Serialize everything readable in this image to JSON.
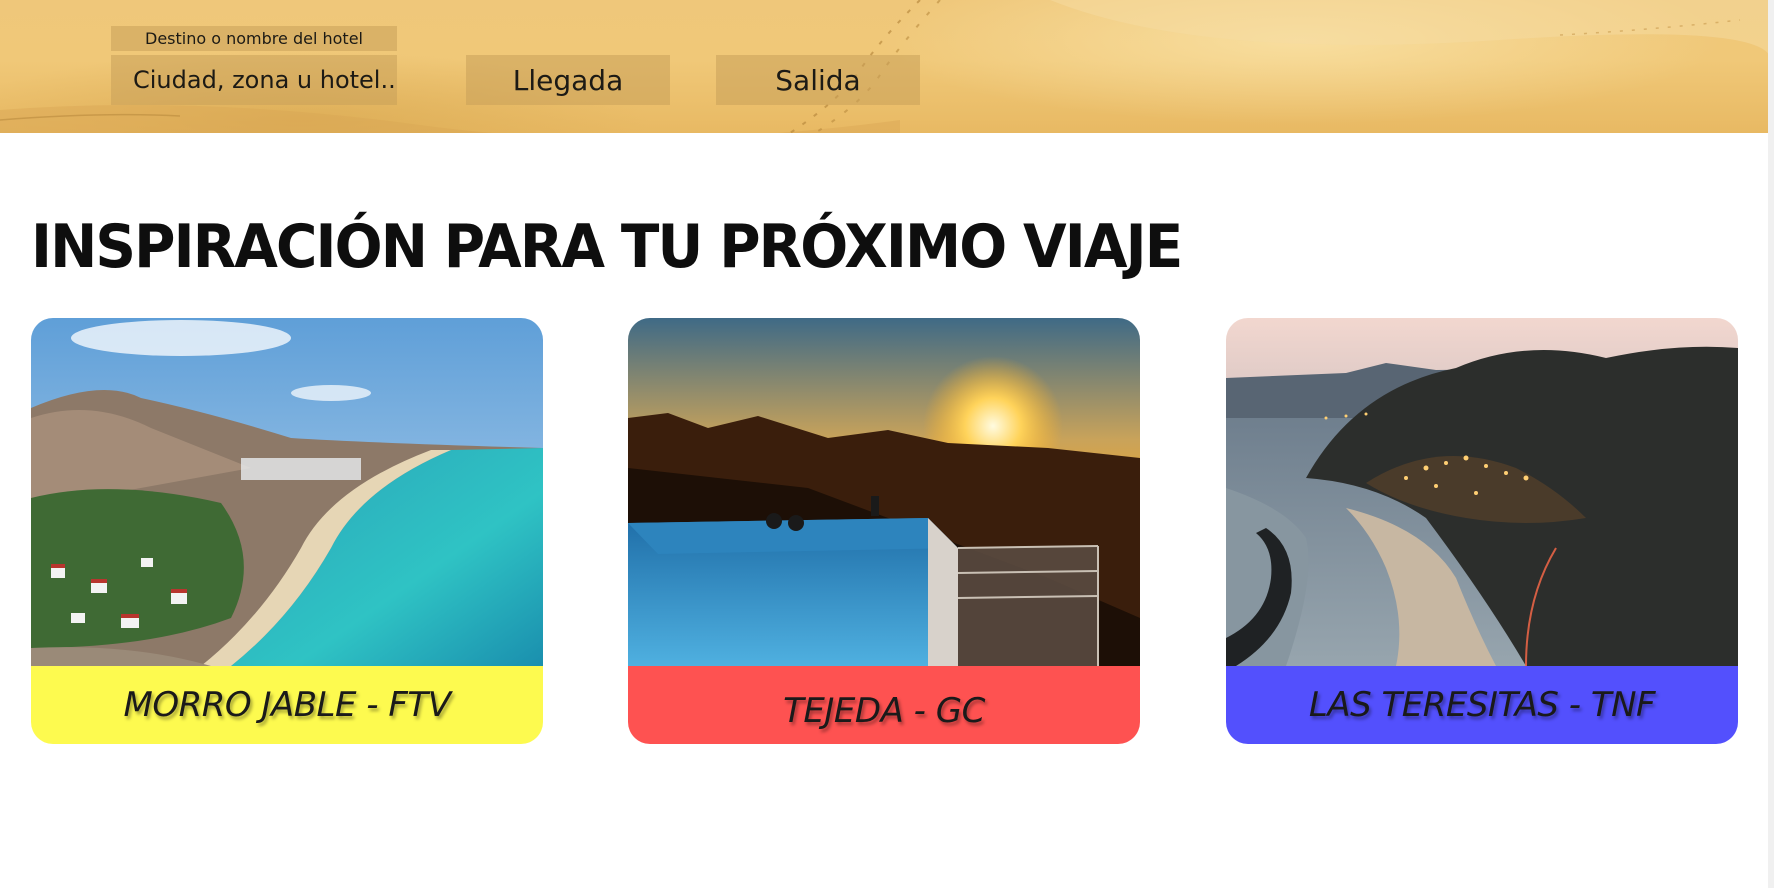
{
  "search": {
    "destination_label": "Destino o nombre del hotel",
    "destination_placeholder": "Ciudad, zona u hotel...",
    "arrival_label": "Llegada",
    "departure_label": "Salida"
  },
  "inspiration": {
    "title": "INSPIRACIÓN PARA TU PRÓXIMO VIAJE",
    "cards": [
      {
        "caption": "MORRO JABLE - FTV",
        "color": "#fdfa4f",
        "photo": "beach-coast-photo"
      },
      {
        "caption": "TEJEDA - GC",
        "color": "#fe5251",
        "photo": "sunset-infinity-pool-photo"
      },
      {
        "caption": "LAS TERESITAS - TNF",
        "color": "#5350fd",
        "photo": "night-bay-town-photo"
      }
    ]
  },
  "colors": {
    "hero_sand": "#efc77a",
    "field_bg": "#d3a860",
    "text_dark": "#1c1a15"
  }
}
